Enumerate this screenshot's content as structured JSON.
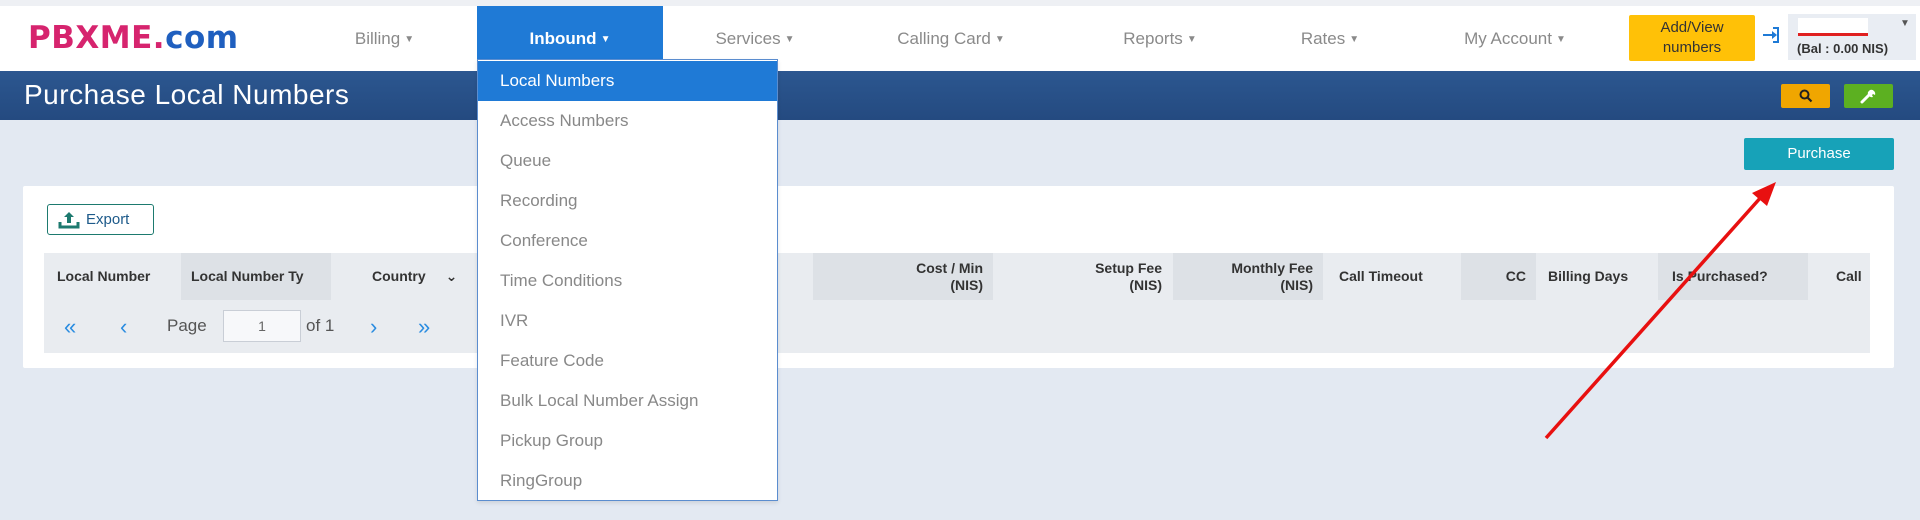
{
  "logo": {
    "text": "PBXME",
    "dot": ".",
    "com": "com"
  },
  "nav": {
    "items": [
      {
        "label": "Billing"
      },
      {
        "label": "Inbound"
      },
      {
        "label": "Services"
      },
      {
        "label": "Calling Card"
      },
      {
        "label": "Reports"
      },
      {
        "label": "Rates"
      },
      {
        "label": "My Account"
      }
    ],
    "add_view_line1": "Add/View",
    "add_view_line2": "numbers",
    "balance": "(Bal : 0.00 NIS)"
  },
  "page": {
    "title": "Purchase Local Numbers"
  },
  "toolbar": {
    "purchase_label": "Purchase",
    "export_label": "Export"
  },
  "inbound_menu": [
    "Local Numbers",
    "Access Numbers",
    "Queue",
    "Recording",
    "Conference",
    "Time Conditions",
    "IVR",
    "Feature Code",
    "Bulk Local Number Assign",
    "Pickup Group",
    "RingGroup"
  ],
  "table": {
    "columns": [
      "Local Number",
      "Local Number Ty",
      "Country",
      "Cost / Min (NIS)",
      "Setup Fee (NIS)",
      "Monthly Fee (NIS)",
      "Call Timeout",
      "CC",
      "Billing Days",
      "Is Purchased?",
      "Call"
    ],
    "cost_min_line1": "Cost / Min",
    "cost_min_line2": "(NIS)",
    "setup_line1": "Setup Fee",
    "setup_line2": "(NIS)",
    "monthly_line1": "Monthly Fee",
    "monthly_line2": "(NIS)"
  },
  "pager": {
    "page_label": "Page",
    "page_value": "1",
    "of_label": "of 1"
  },
  "colors": {
    "nav_active": "#1f7ad6",
    "title_bar": "#2c5790",
    "purchase": "#17a2b8",
    "add_view": "#ffc107",
    "annotation_arrow": "#e81010"
  }
}
